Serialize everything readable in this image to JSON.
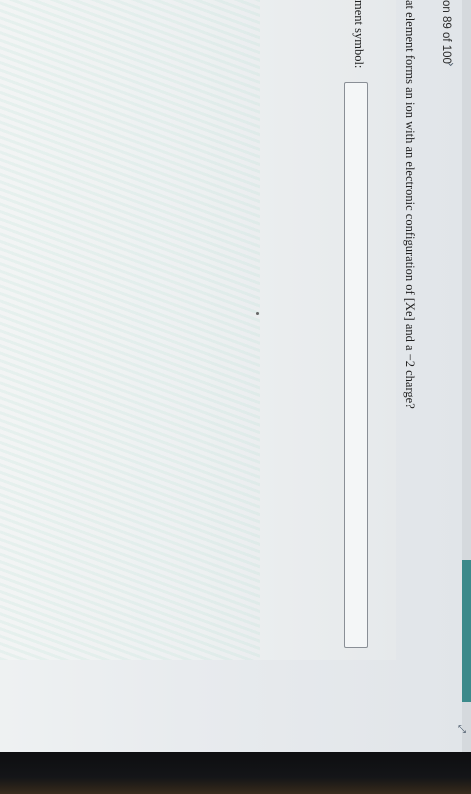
{
  "nav": {
    "question_counter": "on 89 of 100",
    "next_chevron": "›"
  },
  "question": {
    "text": "at element forms an ion with an electronic configuration of [Xe] and a −2 charge?"
  },
  "answer": {
    "label": "ment symbol:",
    "value": ""
  },
  "controls": {
    "expand_icon": "⤢"
  }
}
